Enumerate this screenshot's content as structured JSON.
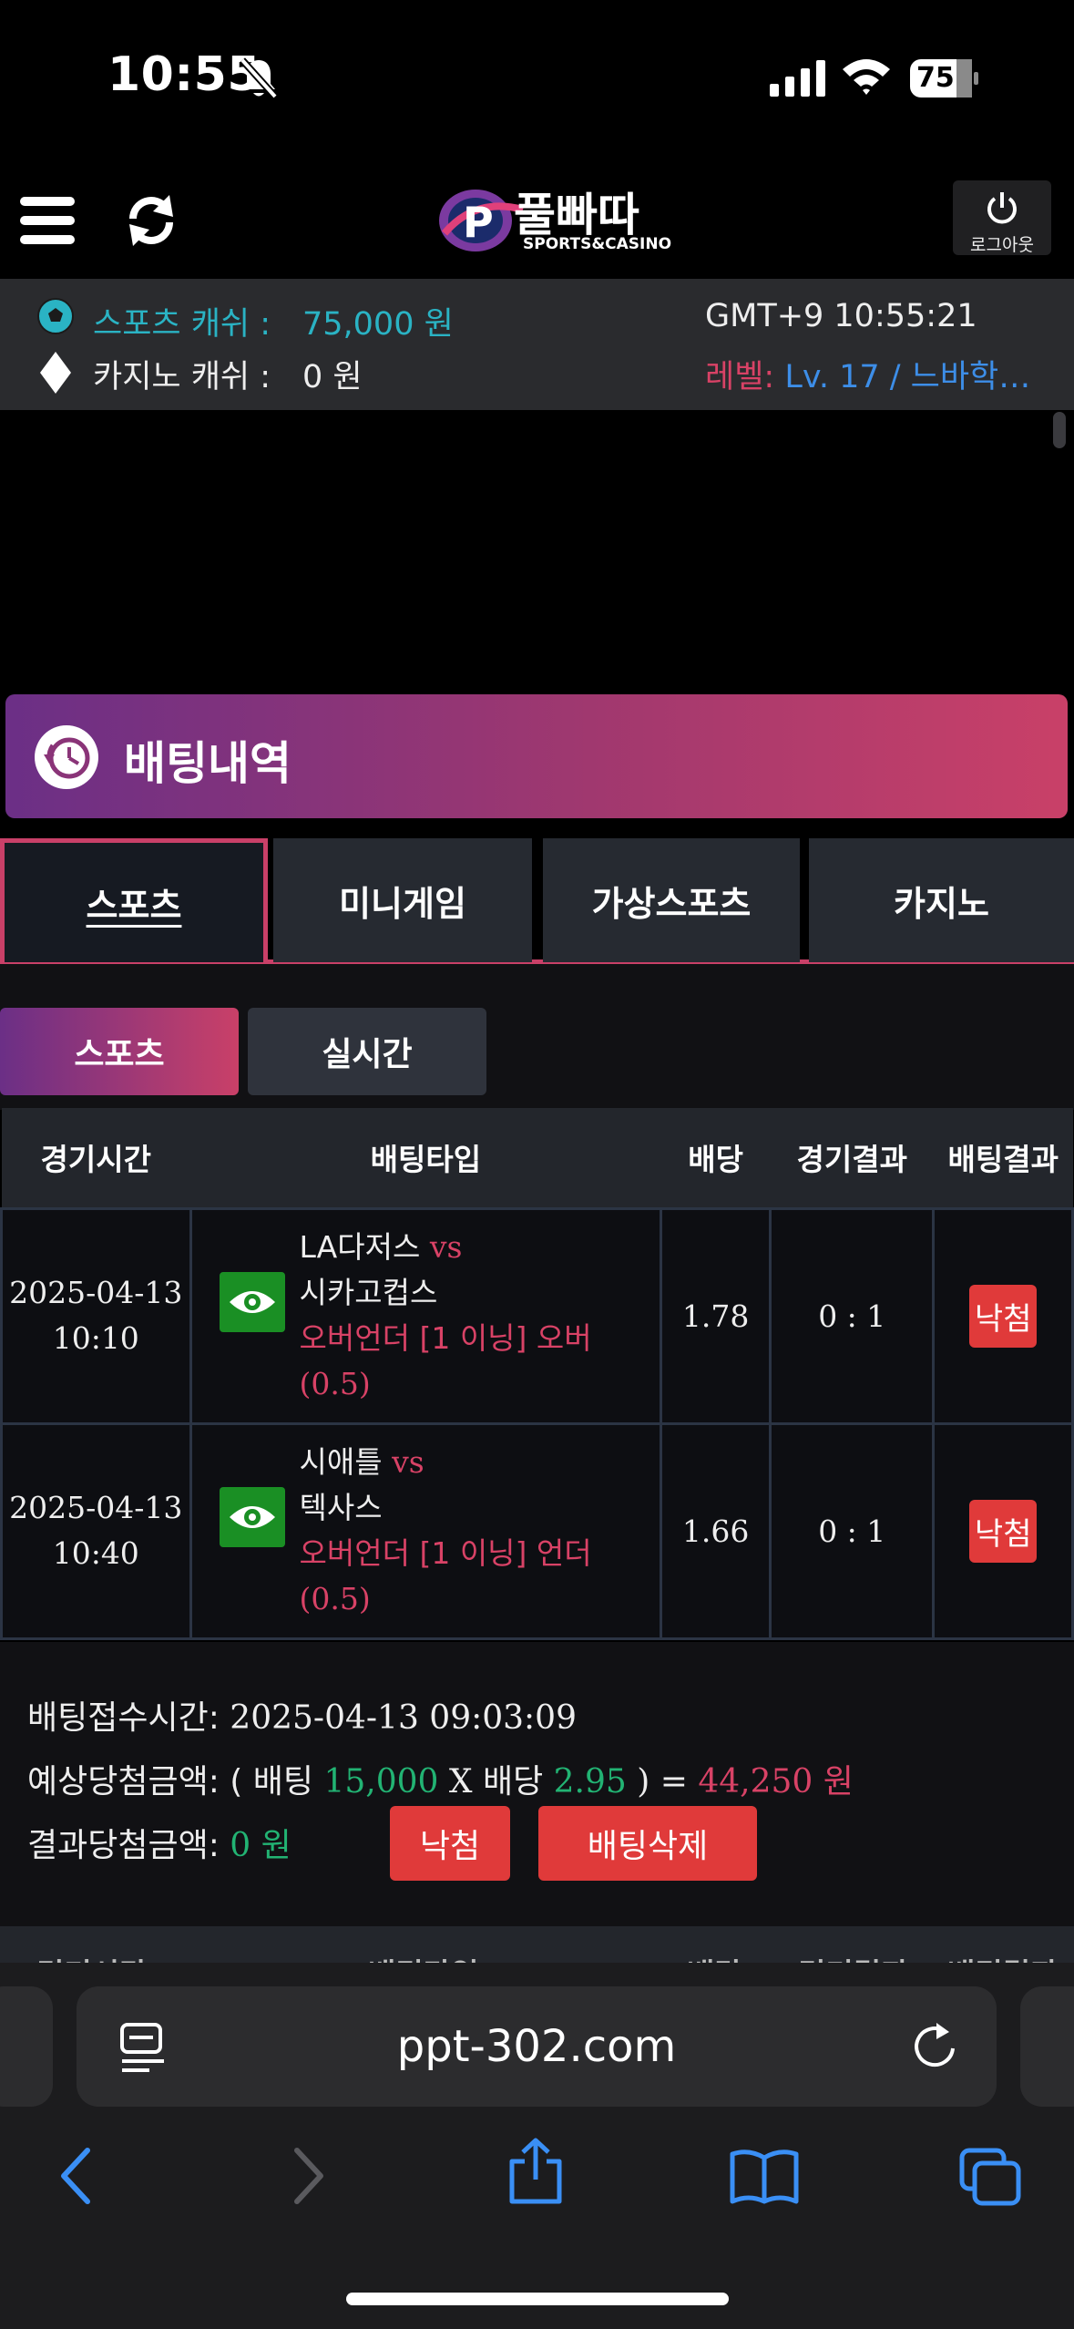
{
  "status_bar": {
    "time": "10:55",
    "battery": "75"
  },
  "header": {
    "logo_main": "풀빠따",
    "logo_sub": "SPORTS&CASINO",
    "logout_label": "로그아웃"
  },
  "info": {
    "sports_cash_label": "스포츠 캐쉬 :",
    "sports_cash_value": "75,000 원",
    "casino_cash_label": "카지노 캐쉬 :",
    "casino_cash_value": "0 원",
    "clock": "GMT+9 10:55:21",
    "level_prefix": "레벨: ",
    "level_value": "Lv. 17 / 느바학…"
  },
  "section": {
    "title": "배팅내역"
  },
  "tabs": [
    {
      "label": "스포츠",
      "active": true
    },
    {
      "label": "미니게임",
      "active": false
    },
    {
      "label": "가상스포츠",
      "active": false
    },
    {
      "label": "카지노",
      "active": false
    }
  ],
  "subtabs": [
    {
      "label": "스포츠",
      "active": true
    },
    {
      "label": "실시간",
      "active": false
    }
  ],
  "table": {
    "headers": [
      "경기시간",
      "배팅타입",
      "배당",
      "경기결과",
      "배팅결과"
    ],
    "rows": [
      {
        "date": "2025-04-13",
        "time": "10:10",
        "home": "LA다저스",
        "vs": "vs",
        "away": "시카고컵스",
        "bet_type": "오버언더 [1 이닝] 오버",
        "line": "(0.5)",
        "odds": "1.78",
        "score": "0 : 1",
        "result": "낙첨"
      },
      {
        "date": "2025-04-13",
        "time": "10:40",
        "home": "시애틀",
        "vs": "vs",
        "away": "텍사스",
        "bet_type": "오버언더 [1 이닝] 언더",
        "line": "(0.5)",
        "odds": "1.66",
        "score": "0 : 1",
        "result": "낙첨"
      }
    ]
  },
  "summary": {
    "received_label": "배팅접수시간: ",
    "received_value": "2025-04-13 09:03:09",
    "expected_label": "예상당첨금액: ( 배팅 ",
    "stake": "15,000",
    "x_label": " X 배당 ",
    "total_odds": "2.95",
    "close_eq": " ) = ",
    "expected_win": "44,250 원",
    "result_label": "결과당첨금액: ",
    "result_value": "0 원",
    "lose_button": "낙첨",
    "delete_button": "배팅삭제"
  },
  "next_headers": [
    "경기시간",
    "배팅타입",
    "배당",
    "경기결과",
    "배팅결과"
  ],
  "browser": {
    "url": "ppt-302.com"
  },
  "colors": {
    "accent_pink": "#c94068",
    "accent_purple": "#6b2f86",
    "cyan": "#2ab3c4",
    "green": "#22b373",
    "red": "#e03a3a"
  }
}
